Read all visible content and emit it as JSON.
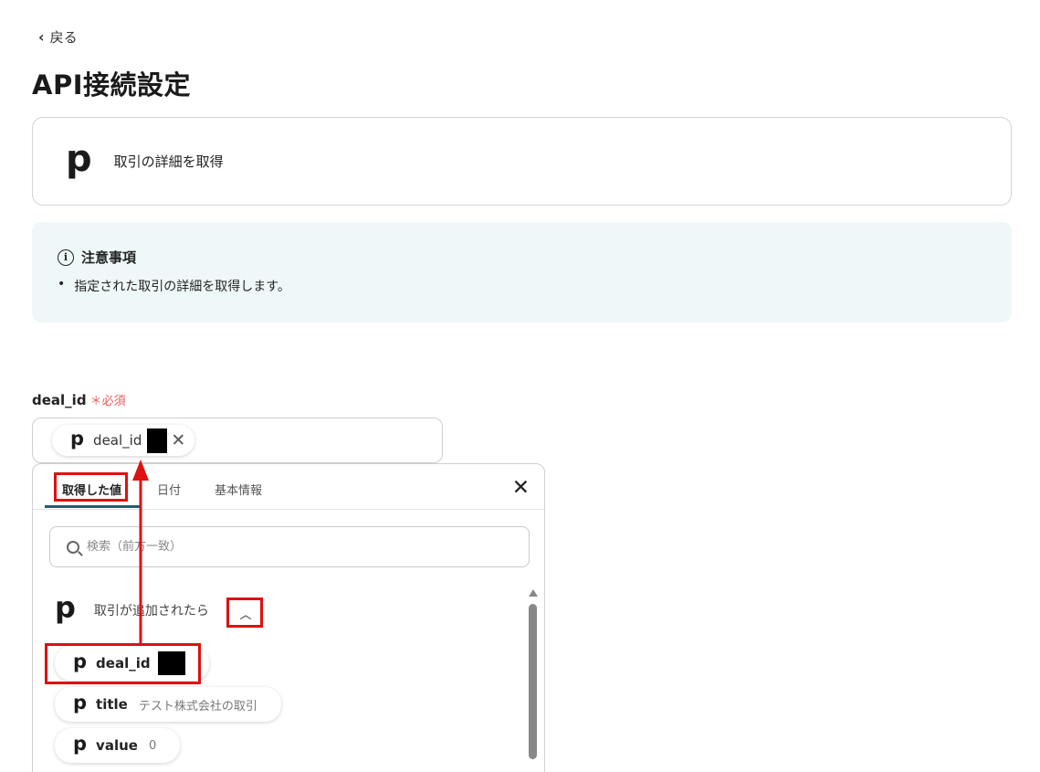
{
  "nav": {
    "back_label": "戻る"
  },
  "page": {
    "title": "API接続設定"
  },
  "app_card": {
    "logo_letter": "p",
    "action": "取引の詳細を取得"
  },
  "notice": {
    "heading": "注意事項",
    "items": [
      "指定された取引の詳細を取得します。"
    ]
  },
  "field": {
    "label": "deal_id",
    "required_label": "＊必須",
    "chip_label": "deal_id"
  },
  "panel": {
    "tabs": [
      "取得した値",
      "日付",
      "基本情報"
    ],
    "search_placeholder": "検索（前方一致）",
    "group_name": "取引が追加されたら",
    "items": [
      {
        "key": "deal_id",
        "value": ""
      },
      {
        "key": "title",
        "value": "テスト株式会社の取引"
      },
      {
        "key": "value",
        "value": "0"
      }
    ]
  },
  "icons": {
    "back": "chevron-left-icon",
    "info": "info-circle-icon",
    "close": "close-icon",
    "search": "search-icon",
    "collapse": "chevron-up-icon",
    "app": "pipedrive-logo-icon"
  },
  "colors": {
    "accent_tab": "#1e5f74",
    "notice_bg": "#eff8f8",
    "required": "#e85a5a",
    "annotation": "#e01010"
  }
}
